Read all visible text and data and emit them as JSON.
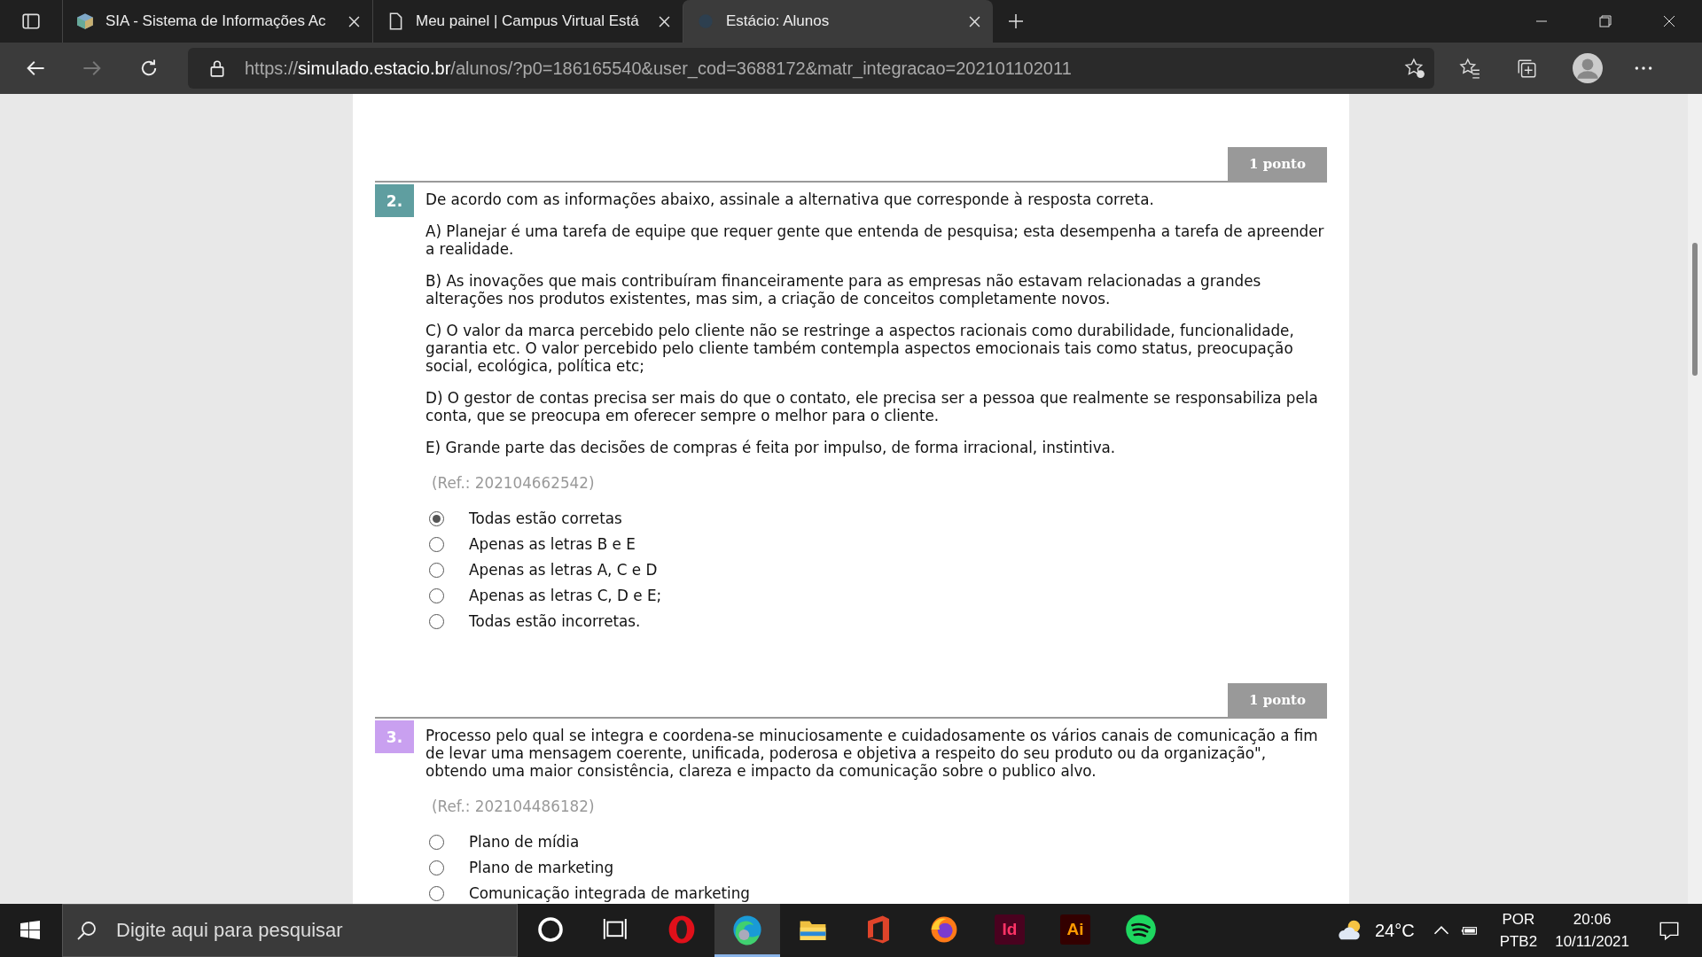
{
  "browser": {
    "tabs": [
      {
        "title": "SIA - Sistema de Informações Ac",
        "kind": "cube",
        "selected": false
      },
      {
        "title": "Meu painel | Campus Virtual Está",
        "kind": "page",
        "selected": false
      },
      {
        "title": "Estácio: Alunos",
        "kind": "blank",
        "selected": true
      }
    ],
    "url_prefix": "https://",
    "url_host": "simulado.estacio.br",
    "url_path": "/alunos/?p0=186165540&user_cod=3688172&matr_integracao=202101102011"
  },
  "questions": [
    {
      "points": "1 ponto",
      "number": "2.",
      "color": "#5f9ea0",
      "statement": "De acordo com as informações abaixo, assinale a alternativa que corresponde à resposta correta.",
      "paragraphs": [
        "A) Planejar é uma tarefa de equipe que requer gente que entenda de pesquisa; esta desempenha a tarefa de apreender a realidade.",
        "B) As inovações que mais contribuíram financeiramente para as empresas não estavam relacionadas a grandes alterações nos produtos existentes, mas sim, a criação de conceitos completamente novos.",
        "C) O valor da marca percebido pelo cliente não se restringe a aspectos racionais como durabilidade, funcionalidade, garantia etc. O valor percebido pelo cliente também contempla aspectos emocionais tais como status, preocupação social, ecológica, política etc;",
        "D) O gestor de contas precisa ser mais do que o contato, ele precisa ser a pessoa que realmente se responsabiliza pela conta, que se preocupa em oferecer sempre o melhor para o cliente.",
        "E) Grande parte das decisões de compras é feita por impulso, de forma irracional, instintiva."
      ],
      "ref": "(Ref.: 202104662542)",
      "options": [
        {
          "label": "Todas estão corretas",
          "selected": true
        },
        {
          "label": "Apenas as letras B e E",
          "selected": false
        },
        {
          "label": "Apenas as letras A, C e D",
          "selected": false
        },
        {
          "label": "Apenas as letras C, D e E;",
          "selected": false
        },
        {
          "label": "Todas estão incorretas.",
          "selected": false
        }
      ]
    },
    {
      "points": "1 ponto",
      "number": "3.",
      "color": "#c9a0f0",
      "statement": "Processo pelo qual se integra e coordena-se minuciosamente e cuidadosamente os vários canais de comunicação a fim de levar uma mensagem coerente, unificada, poderosa e objetiva a respeito do seu produto ou da organização\", obtendo uma maior consistência, clareza e impacto da comunicação sobre o publico alvo.",
      "ref": "(Ref.: 202104486182)",
      "options": [
        {
          "label": "Plano de mídia",
          "selected": false
        },
        {
          "label": "Plano de marketing",
          "selected": false
        },
        {
          "label": "Comunicação integrada de marketing",
          "selected": false
        }
      ]
    }
  ],
  "taskbar": {
    "search_placeholder": "Digite aqui para pesquisar",
    "apps": [
      {
        "kind": "cortana",
        "active": false
      },
      {
        "kind": "taskview",
        "active": false
      },
      {
        "kind": "opera",
        "active": false
      },
      {
        "kind": "edge",
        "active": true
      },
      {
        "kind": "explorer",
        "active": false
      },
      {
        "kind": "office",
        "active": false
      },
      {
        "kind": "firefox",
        "active": false
      },
      {
        "kind": "indesign",
        "active": false
      },
      {
        "kind": "illustrator",
        "active": false
      },
      {
        "kind": "spotify",
        "active": false
      }
    ],
    "app_labels": {
      "indesign": "Id",
      "illustrator": "Ai"
    },
    "temperature": "24°C",
    "language": "POR",
    "layout": "PTB2",
    "time": "20:06",
    "date": "10/11/2021"
  }
}
